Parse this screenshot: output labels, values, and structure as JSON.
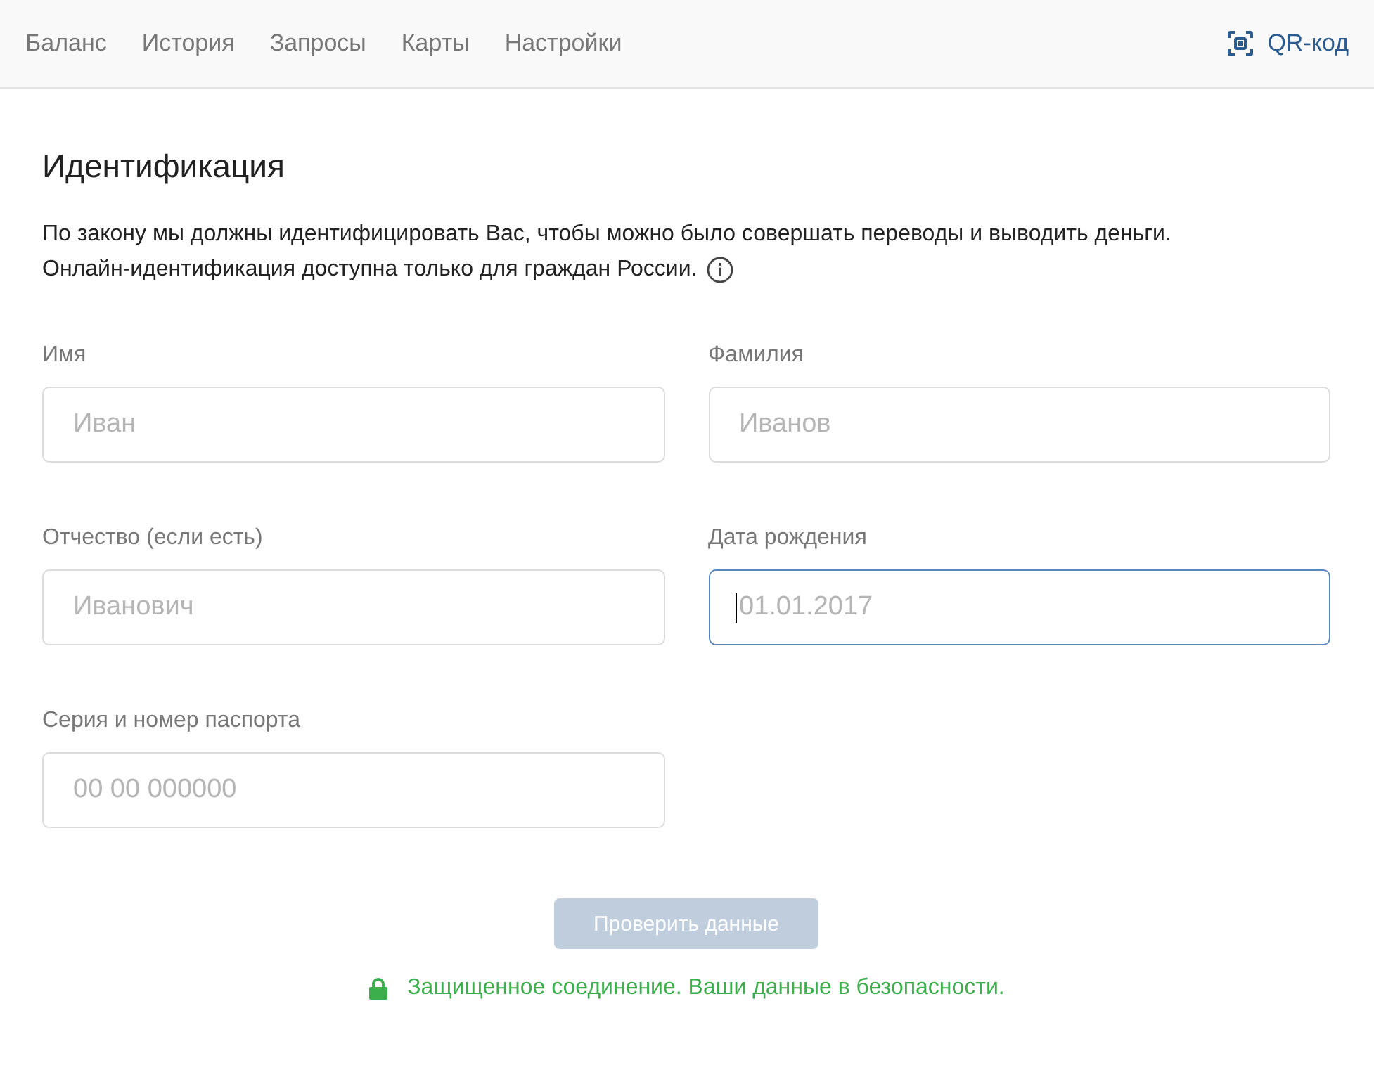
{
  "nav": {
    "items": [
      {
        "label": "Баланс",
        "selected": false
      },
      {
        "label": "История",
        "selected": false
      },
      {
        "label": "Запросы",
        "selected": false
      },
      {
        "label": "Карты",
        "selected": false
      },
      {
        "label": "Настройки",
        "selected": false
      }
    ],
    "qr_link": "QR-код"
  },
  "title": "Идентификация",
  "description": [
    "По закону мы должны идентифицировать Вас, чтобы можно было совершать переводы и выводить деньги.",
    "Онлайн-идентификация доступна только для граждан России."
  ],
  "fields": [
    {
      "label": "Имя",
      "placeholder": "Иван",
      "focused": false
    },
    {
      "label": "Фамилия",
      "placeholder": "Иванов",
      "focused": false
    },
    {
      "label": "Отчество (если есть)",
      "placeholder": "Иванович",
      "focused": false
    },
    {
      "label": "Дата рождения",
      "placeholder": "01.01.2017",
      "focused": true
    },
    {
      "label": "Серия и номер паспорта",
      "placeholder": "00 00 000000",
      "focused": false
    }
  ],
  "submit": {
    "label": "Проверить данные",
    "disabled": true
  },
  "secure_note": "Защищенное соединение. Ваши данные в безопасности."
}
